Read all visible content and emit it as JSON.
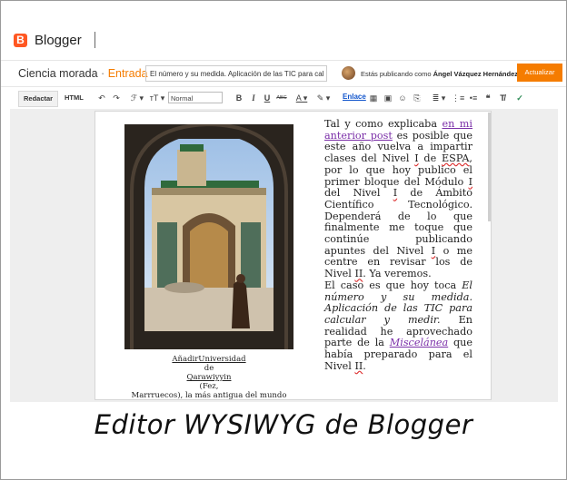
{
  "app": {
    "logo_letter": "B",
    "name": "Blogger"
  },
  "post_header": {
    "blog_name": "Ciencia morada",
    "separator": "·",
    "section": "Entrada",
    "title_value": "El número y su medida. Aplicación de las TIC para cal",
    "publishing_as_prefix": "Estás publicando como",
    "publishing_as_user": "Ángel Vázquez Hernández",
    "update_button": "Actualizar"
  },
  "toolbar": {
    "tab_compose": "Redactar",
    "tab_html": "HTML",
    "undo": "↶",
    "redo": "↷",
    "font_family": "ℱ ▾",
    "font_size": "тT ▾",
    "format_select": "Normal",
    "bold": "B",
    "italic": "I",
    "underline": "U",
    "strike": "ABC",
    "text_color": "A ▾",
    "highlight": "✎ ▾",
    "link": "Enlace",
    "image": "▦",
    "video": "▣",
    "emoji": "☺",
    "jump_break": "⎘",
    "align": "≣ ▾",
    "numbered_list": "⋮≡",
    "bullet_list": "•≡",
    "quote": "❝",
    "clear_format": "T̸",
    "spellcheck": "✓"
  },
  "caption": {
    "line1_underlined": "AñadirUniversidad",
    "line2": "de",
    "line3_underlined": "Qarawiyyin",
    "line4": "(Fez,",
    "line5": "Marrruecos), la más antigua del mundo"
  },
  "article": {
    "t1": "Tal y como explicaba ",
    "link1": "en mi anterior post",
    "t2": " es posible que este año vuelva a impartir clases del Nivel ",
    "sq1": "I",
    "t3": " de ",
    "sq2": "ESPA",
    "t4": ", por lo que hoy publico el primer bloque del Módulo ",
    "sq3": "I",
    "t5": " del Nivel ",
    "sq4": "I",
    "t6": " de Ámbito Científico Tecnológico. Dependerá de lo que finalmente me toque que continúe publicando apuntes del Nivel ",
    "sq5": "I",
    "t7": " o me centre en revisar los de Nivel ",
    "sq6": "II",
    "t8": ". Ya veremos.",
    "p2a": "El caso es que hoy toca ",
    "p2i": "El número y su medida. Aplicación de las TIC para calcular y medir.",
    "p2b": " En realidad he aprovechado parte de la ",
    "link2": "Miscelánea",
    "p2c": " que había preparado para el Nivel ",
    "sq7": "II",
    "p2d": "."
  },
  "footer": {
    "caption": "Editor WYSIWYG de Blogger"
  },
  "colors": {
    "brand_orange": "#ff5722",
    "accent_orange": "#f57c00",
    "link_purple": "#7b2fa8",
    "link_blue": "#1155cc"
  }
}
